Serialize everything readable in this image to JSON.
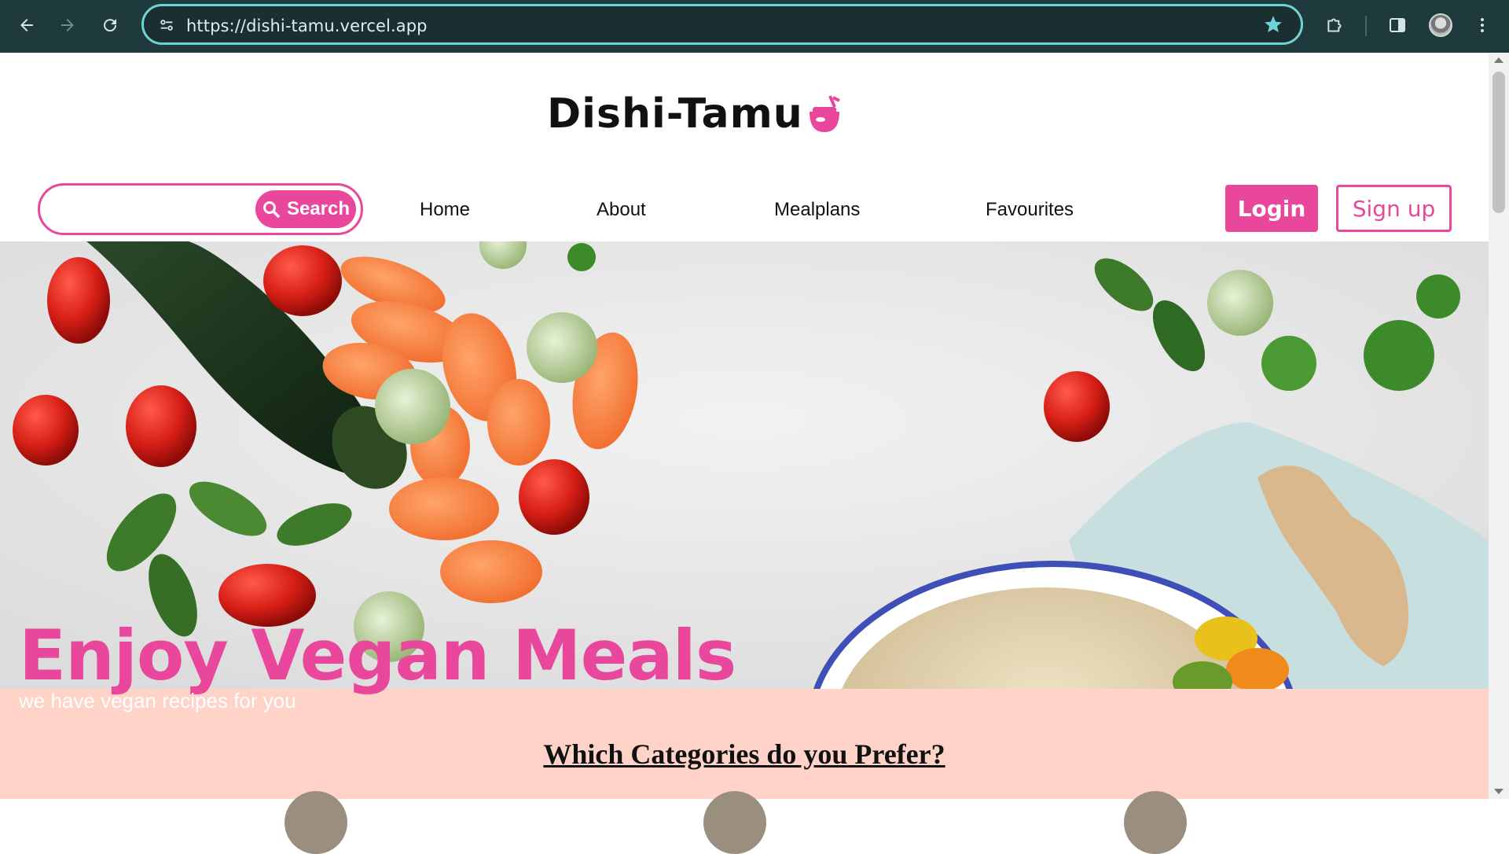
{
  "browser": {
    "url": "https://dishi-tamu.vercel.app",
    "back_icon": "arrow-left-icon",
    "forward_icon": "arrow-right-icon",
    "reload_icon": "reload-icon",
    "bookmark_icon": "star-icon",
    "extensions_icon": "puzzle-icon",
    "sidepanel_icon": "side-panel-icon",
    "menu_icon": "kebab-menu-icon",
    "accent_color": "#6ed3d7"
  },
  "header": {
    "logo_text": "Dishi-Tamu",
    "search": {
      "placeholder": "",
      "button_label": "Search"
    },
    "nav": [
      {
        "label": "Home"
      },
      {
        "label": "About"
      },
      {
        "label": "Mealplans"
      },
      {
        "label": "Favourites"
      }
    ],
    "login_label": "Login",
    "signup_label": "Sign up",
    "brand_color": "#e8479b"
  },
  "hero": {
    "title": "Enjoy Vegan Meals",
    "subtitle": "we have vegan recipes for you"
  },
  "categories": {
    "title": "Which Categories do you Prefer?",
    "background_color": "#ffd3c8"
  }
}
